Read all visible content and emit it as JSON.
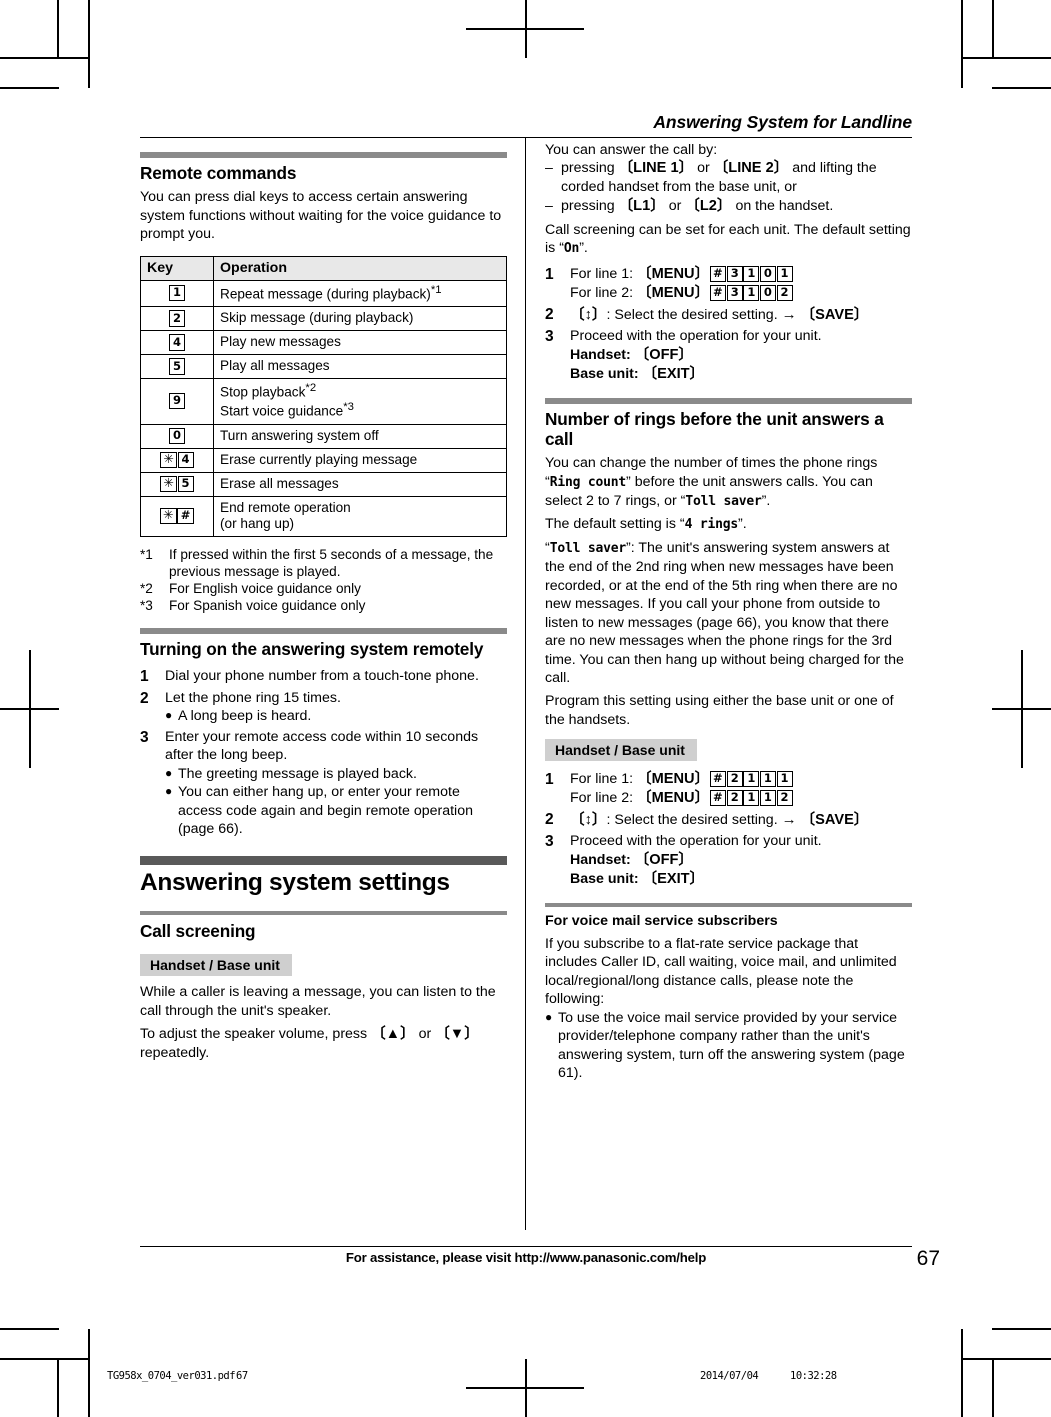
{
  "running_head": "Answering System for Landline",
  "left_column": {
    "remote_commands": {
      "heading": "Remote commands",
      "intro": "You can press dial keys to access certain answering system functions without waiting for the voice guidance to prompt you.",
      "table": {
        "headers": [
          "Key",
          "Operation"
        ],
        "rows": [
          {
            "keys": [
              "1"
            ],
            "operation": "Repeat message (during playback)",
            "sup": "*1"
          },
          {
            "keys": [
              "2"
            ],
            "operation": "Skip message (during playback)",
            "sup": ""
          },
          {
            "keys": [
              "4"
            ],
            "operation": "Play new messages",
            "sup": ""
          },
          {
            "keys": [
              "5"
            ],
            "operation": "Play all messages",
            "sup": ""
          },
          {
            "keys": [
              "9"
            ],
            "operation": "Stop playback",
            "sup": "*2",
            "operation2": "Start voice guidance",
            "sup2": "*3"
          },
          {
            "keys": [
              "0"
            ],
            "operation": "Turn answering system off",
            "sup": ""
          },
          {
            "keys": [
              "*",
              "4"
            ],
            "operation": "Erase currently playing message",
            "sup": ""
          },
          {
            "keys": [
              "*",
              "5"
            ],
            "operation": "Erase all messages",
            "sup": ""
          },
          {
            "keys": [
              "*",
              "#"
            ],
            "operation": "End remote operation",
            "sup": "",
            "operation2": "(or hang up)",
            "sup2": ""
          }
        ]
      },
      "footnotes": [
        {
          "mark": "*1",
          "text": "If pressed within the first 5 seconds of a message, the previous message is played."
        },
        {
          "mark": "*2",
          "text": "For English voice guidance only"
        },
        {
          "mark": "*3",
          "text": "For Spanish voice guidance only"
        }
      ]
    },
    "turning_on_remotely": {
      "heading": "Turning on the answering system remotely",
      "steps": [
        {
          "num": "1",
          "text": "Dial your phone number from a touch-tone phone.",
          "bullets": []
        },
        {
          "num": "2",
          "text": "Let the phone ring 15 times.",
          "bullets": [
            "A long beep is heard."
          ]
        },
        {
          "num": "3",
          "text": "Enter your remote access code within 10 seconds after the long beep.",
          "bullets": [
            "The greeting message is played back.",
            "You can either hang up, or enter your remote access code again and begin remote operation (page 66)."
          ]
        }
      ]
    },
    "chapter": {
      "title": "Answering system settings"
    },
    "call_screening": {
      "heading": "Call screening",
      "unit_tag": "Handset / Base unit",
      "para1": "While a caller is leaving a message, you can listen to the call through the unit's speaker.",
      "para2_pre": "To adjust the speaker volume, press ",
      "para2_key1": "{▲}",
      "para2_mid": " or ",
      "para2_key2": "{▼}",
      "para2_post": " repeatedly."
    }
  },
  "right_column": {
    "call_screening_cont": {
      "intro": "You can answer the call by:",
      "dash_items": [
        {
          "pre": "pressing ",
          "key1": "{LINE 1}",
          "mid": " or ",
          "key2": "{LINE 2}",
          "post": " and lifting the corded handset from the base unit, or"
        },
        {
          "pre": "pressing ",
          "key1": "{L1}",
          "mid": " or ",
          "key2": "{L2}",
          "post": " on the handset."
        }
      ],
      "para_pre": "Call screening can be set for each unit. The default setting is ",
      "para_mono": "On",
      "para_post": ".",
      "steps": [
        {
          "num": "1",
          "line1_label": "For line 1: ",
          "line1_menu": "{MENU}",
          "line1_keys": [
            "#",
            "3",
            "1",
            "0",
            "1"
          ],
          "line2_label": "For line 2: ",
          "line2_menu": "{MENU}",
          "line2_keys": [
            "#",
            "3",
            "1",
            "0",
            "2"
          ]
        },
        {
          "num": "2",
          "key": "{↕}",
          "text": ": Select the desired setting. ",
          "arrow": "→",
          "key2": "{SAVE}"
        },
        {
          "num": "3",
          "text": "Proceed with the operation for your unit.",
          "handset_label": "Handset: ",
          "handset_key": "{OFF}",
          "base_label": "Base unit: ",
          "base_key": "{EXIT}"
        }
      ]
    },
    "ring_count": {
      "heading": "Number of rings before the unit answers a call",
      "p1_a": "You can change the number of times the phone rings ",
      "p1_m1": "Ring count",
      "p1_b": " before the unit answers calls. You can select 2 to 7 rings, or ",
      "p1_m2": "Toll saver",
      "p1_c": ".",
      "p2_a": "The default setting is ",
      "p2_m": "4 rings",
      "p2_b": ".",
      "p3_m": "Toll saver",
      "p3_text": ": The unit's answering system answers at the end of the 2nd ring when new messages have been recorded, or at the end of the 5th ring when there are no new messages. If you call your phone from outside to listen to new messages (page 66), you know that there are no new messages when the phone rings for the 3rd time. You can then hang up without being charged for the call.",
      "p4_text": "Program this setting using either the base unit or one of the handsets.",
      "unit_tag": "Handset / Base unit",
      "steps": [
        {
          "num": "1",
          "line1_label": "For line 1: ",
          "line1_menu": "{MENU}",
          "line1_keys": [
            "#",
            "2",
            "1",
            "1",
            "1"
          ],
          "line2_label": "For line 2: ",
          "line2_menu": "{MENU}",
          "line2_keys": [
            "#",
            "2",
            "1",
            "1",
            "2"
          ]
        },
        {
          "num": "2",
          "key": "{↕}",
          "text": ": Select the desired setting. ",
          "arrow": "→",
          "key2": "{SAVE}"
        },
        {
          "num": "3",
          "text": "Proceed with the operation for your unit.",
          "handset_label": "Handset: ",
          "handset_key": "{OFF}",
          "base_label": "Base unit: ",
          "base_key": "{EXIT}"
        }
      ]
    },
    "voice_mail": {
      "heading": "For voice mail service subscribers",
      "para": "If you subscribe to a flat-rate service package that includes Caller ID, call waiting, voice mail, and unlimited local/regional/long distance calls, please note the following:",
      "bullets": [
        "To use the voice mail service provided by your service provider/telephone company rather than the unit's answering system, turn off the answering system (page 61)."
      ]
    }
  },
  "footer": {
    "text": "For assistance, please visit http://www.panasonic.com/help",
    "page_number": "67"
  },
  "pdf_strip": {
    "filename": "TG958x_0704_ver031.pdf",
    "page": "67",
    "date": "2014/07/04",
    "time": "10:32:28"
  }
}
